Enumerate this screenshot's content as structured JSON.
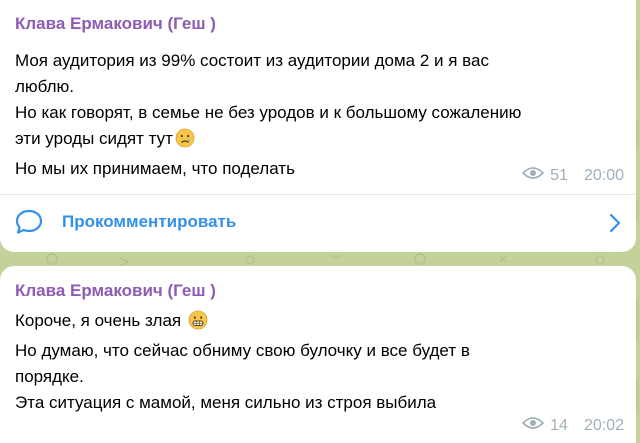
{
  "colors": {
    "background": "#c2d29a",
    "card": "#ffffff",
    "author": "#8e5bb5",
    "link": "#3390ec",
    "meta": "#9fb0ba"
  },
  "posts": [
    {
      "author": "Клава Ермакович (Геш )",
      "lines": [
        "Моя аудитория из 99% состоит из аудитории дома 2 и я вас",
        "люблю.",
        "Но как говорят, в семье не без уродов и к большому сожалению",
        "эти уроды сидят тут",
        "Но мы их принимаем, что поделать"
      ],
      "emoji_on_line_4": "crying-face-emoji",
      "views": "51",
      "time": "20:00",
      "comment_label": "Прокомментировать"
    },
    {
      "author": "Клава Ермакович (Геш )",
      "lines": [
        "Короче, я очень злая",
        "Но думаю, что сейчас обниму свою булочку и все будет в",
        "порядке.",
        "Эта ситуация с мамой, меня сильно из строя выбила"
      ],
      "emoji_on_line_1": "grimacing-face-emoji",
      "views": "14",
      "time": "20:02"
    }
  ]
}
